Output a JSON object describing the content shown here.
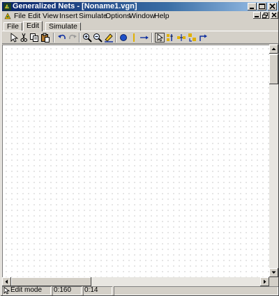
{
  "window": {
    "title": "Generalized Nets - [Noname1.vgn]",
    "title_icon": "gn-app-icon",
    "controls": [
      "minimize-icon",
      "maximize-icon",
      "close-icon"
    ]
  },
  "menubar": {
    "items": [
      "File",
      "Edit",
      "View",
      "Insert",
      "Simulate",
      "Options",
      "Window",
      "Help"
    ],
    "mdi_controls": [
      "minimize-icon",
      "restore-icon",
      "close-icon"
    ]
  },
  "tabs": {
    "items": [
      "File",
      "Edit",
      "Simulate"
    ],
    "active": "Edit"
  },
  "toolbar": {
    "buttons": [
      "select-arrow-icon",
      "cut-icon",
      "copy-icon",
      "paste-icon",
      "undo-icon",
      "redo-icon",
      "zoom-in-icon",
      "zoom-out-icon",
      "pen-icon",
      "place-icon",
      "transition-icon",
      "arc-icon",
      "pointer-icon",
      "align-icon",
      "distribute-icon",
      "group-icon",
      "rotate-icon"
    ]
  },
  "statusbar": {
    "mode": "Edit mode",
    "x": "0:160",
    "y": "0:14"
  },
  "colors": {
    "title_gradient_start": "#0a246a",
    "title_gradient_end": "#a6caf0",
    "chrome": "#d4d0c8",
    "canvas": "#ffffff",
    "grid_dot": "#a0a0a0"
  }
}
